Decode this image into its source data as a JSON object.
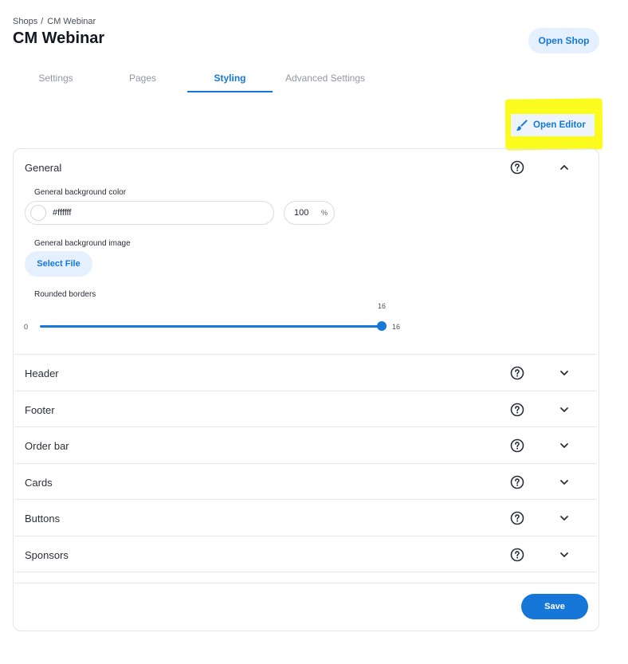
{
  "breadcrumb": {
    "root": "Shops",
    "separator": "/",
    "current": "CM Webinar"
  },
  "page_title": "CM Webinar",
  "open_shop_label": "Open Shop",
  "tabs": [
    {
      "label": "Settings",
      "active": false
    },
    {
      "label": "Pages",
      "active": false
    },
    {
      "label": "Styling",
      "active": true
    },
    {
      "label": "Advanced Settings",
      "active": false
    }
  ],
  "open_editor": {
    "label": "Open Editor",
    "icon": "paintbrush-icon",
    "highlight_color": "#fbfb1e"
  },
  "general": {
    "title": "General",
    "expanded": true,
    "bg_color_label": "General background color",
    "bg_color_value": "#ffffff",
    "opacity_value": "100",
    "opacity_unit": "%",
    "bg_image_label": "General background image",
    "select_file_label": "Select File",
    "rounded_borders_label": "Rounded borders",
    "slider": {
      "min_label": "0",
      "max_label": "16",
      "current_label": "16",
      "value": 16,
      "min": 0,
      "max": 16
    }
  },
  "sections": [
    {
      "title": "Header"
    },
    {
      "title": "Footer"
    },
    {
      "title": "Order bar"
    },
    {
      "title": "Cards"
    },
    {
      "title": "Buttons"
    },
    {
      "title": "Sponsors"
    }
  ],
  "save_label": "Save",
  "colors": {
    "accent": "#1677d8",
    "accent_light": "#e4f0fd",
    "border": "#e3e5e9"
  }
}
